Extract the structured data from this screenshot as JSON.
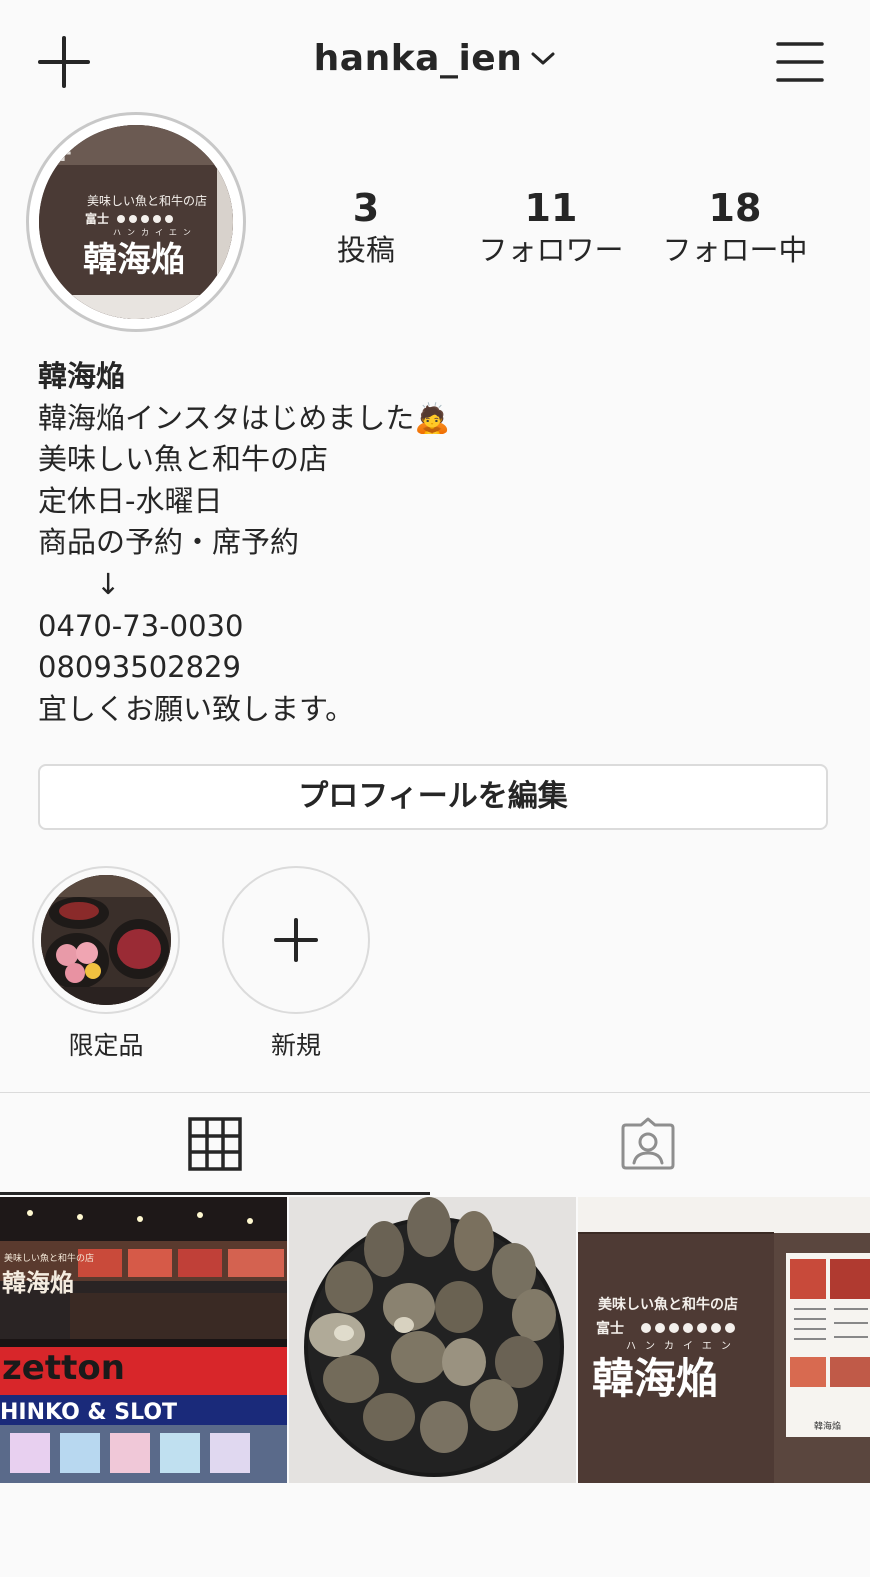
{
  "header": {
    "username": "hanka_ien",
    "icons": [
      "plus-icon",
      "chevron-down-icon",
      "hamburger-menu-icon"
    ]
  },
  "profile": {
    "avatar_sign": {
      "tagline": "美味しい魚と和牛の店",
      "store": "富士",
      "kana": "ハンカイエン",
      "name": "韓海焔"
    },
    "stats": [
      {
        "value": "3",
        "label": "投稿"
      },
      {
        "value": "11",
        "label": "フォロワー"
      },
      {
        "value": "18",
        "label": "フォロー中"
      }
    ]
  },
  "bio": {
    "name": "韓海焔",
    "lines": [
      "韓海焔インスタはじめました🙇",
      "美味しい魚と和牛の店",
      "定休日-水曜日",
      "商品の予約・席予約",
      "↓",
      "0470-73-0030",
      "08093502829",
      "宜しくお願い致します。"
    ]
  },
  "edit_button": "プロフィールを編集",
  "highlights": [
    {
      "label": "限定品"
    },
    {
      "label": "新規"
    }
  ],
  "tabs": [
    "grid-icon",
    "tagged-icon"
  ],
  "posts": {
    "storefront": {
      "sign_name": "韓海焔",
      "zetton": "zetton",
      "pachinko": "HINKO & SLOT"
    },
    "oysters": {},
    "signboard": {
      "tagline": "美味しい魚と和牛の店",
      "store": "富士",
      "kana": "ハンカイエン",
      "name": "韓海焔",
      "menu_name": "韓海焔"
    }
  },
  "colors": {
    "background": "#fafafa",
    "text": "#262626",
    "border": "#dbdbdb",
    "sign_brown": "#4a3a35"
  }
}
